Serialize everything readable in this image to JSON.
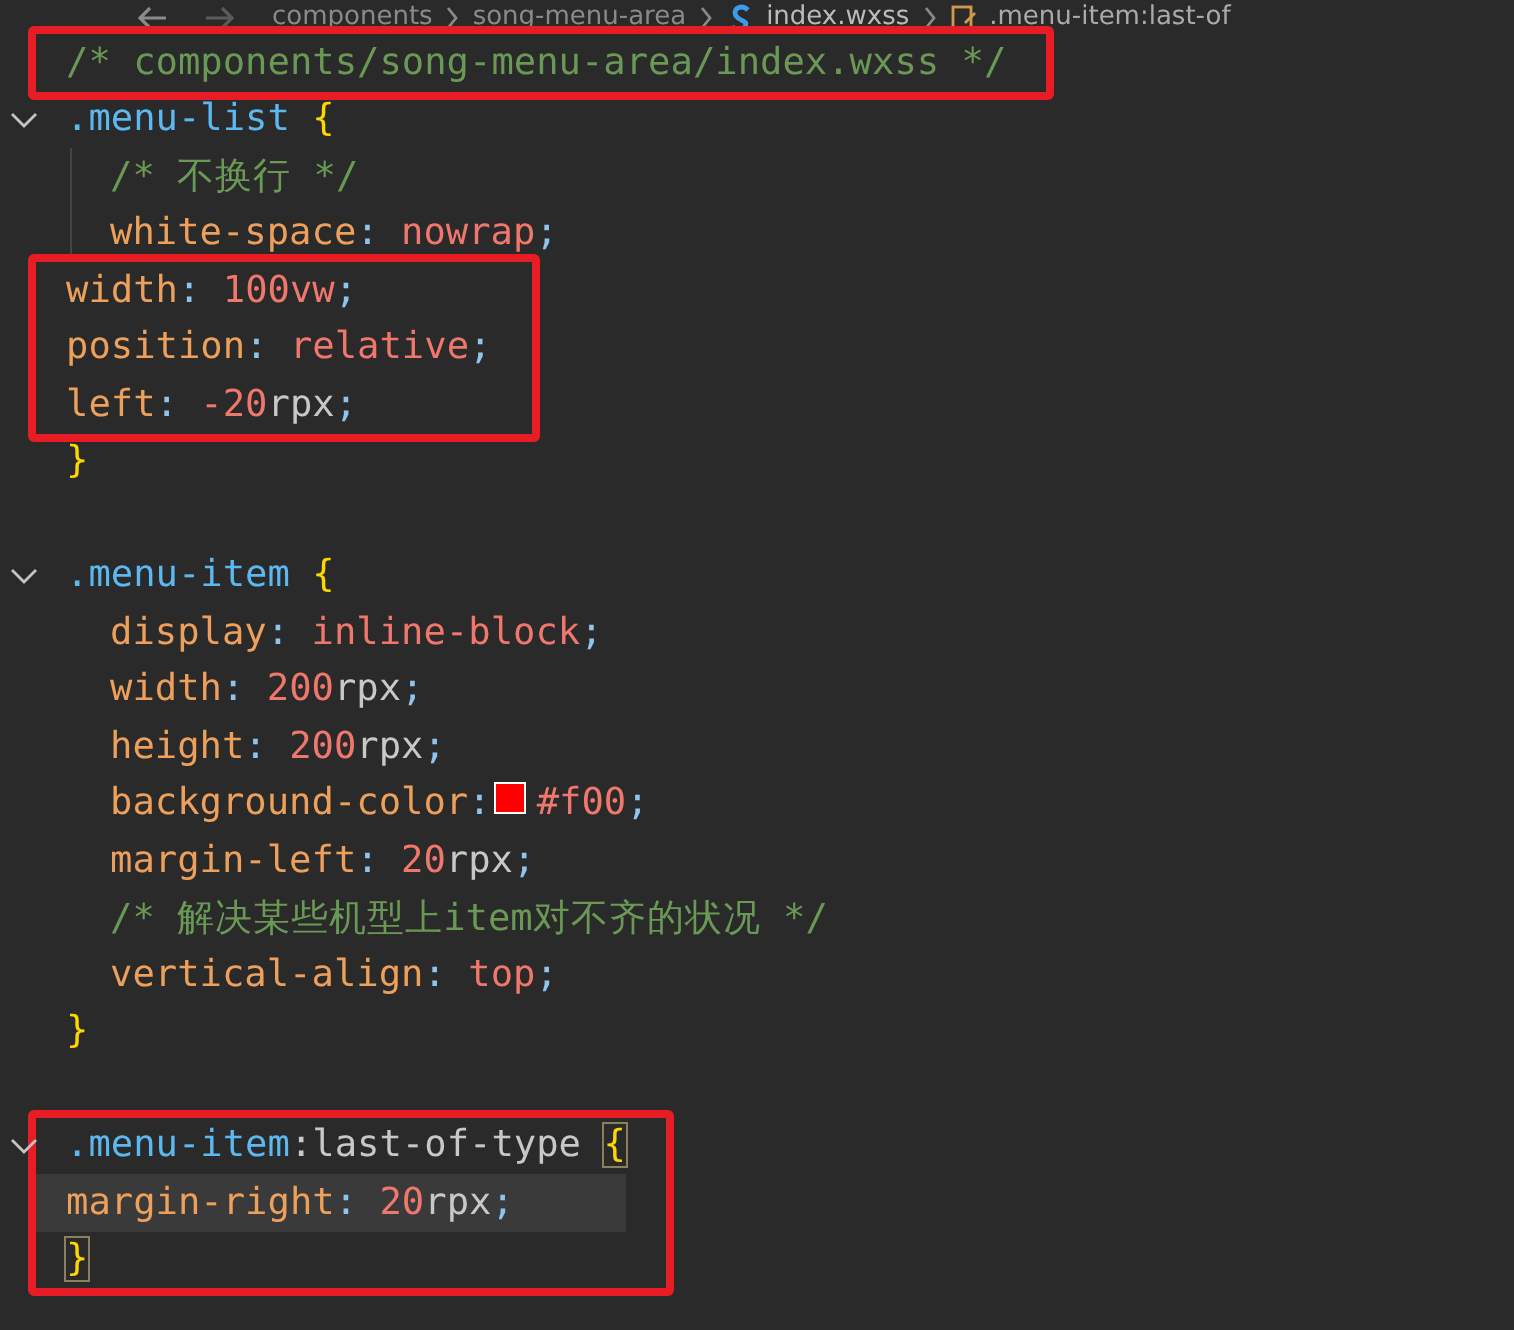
{
  "breadcrumb": [
    {
      "kind": "folder",
      "label": "components"
    },
    {
      "kind": "folder",
      "label": "song-menu-area"
    },
    {
      "kind": "file",
      "label": "index.wxss"
    },
    {
      "kind": "symbol",
      "label": ".menu-item:last-of"
    }
  ],
  "blocks": [
    {
      "boxed": true,
      "lines": [
        {
          "kind": "top",
          "tokens": [
            {
              "kind": "comment",
              "text": "/* components/song-menu-area/index.wxss */"
            }
          ]
        }
      ]
    },
    {
      "boxed": false,
      "lines": [
        {
          "kind": "rule",
          "expanded": true,
          "tokens": [
            {
              "kind": "sel",
              "text": ".menu-list"
            },
            {
              "kind": "brace",
              "text": " {"
            }
          ]
        },
        {
          "kind": "decl",
          "tokens": [
            {
              "kind": "comment",
              "text": "/* 不换行 */"
            }
          ]
        },
        {
          "kind": "decl",
          "tokens": [
            {
              "kind": "prop",
              "text": "white-space"
            },
            {
              "kind": "punct",
              "text": ": "
            },
            {
              "kind": "val",
              "text": "nowrap"
            },
            {
              "kind": "punct",
              "text": ";"
            }
          ]
        }
      ]
    },
    {
      "boxed": true,
      "lines": [
        {
          "kind": "decl",
          "tokens": [
            {
              "kind": "prop",
              "text": "width"
            },
            {
              "kind": "punct",
              "text": ": "
            },
            {
              "kind": "val",
              "text": "100vw"
            },
            {
              "kind": "punct",
              "text": ";"
            }
          ]
        },
        {
          "kind": "decl",
          "tokens": [
            {
              "kind": "prop",
              "text": "position"
            },
            {
              "kind": "punct",
              "text": ": "
            },
            {
              "kind": "val",
              "text": "relative"
            },
            {
              "kind": "punct",
              "text": ";"
            }
          ]
        },
        {
          "kind": "decl",
          "tokens": [
            {
              "kind": "prop",
              "text": "left"
            },
            {
              "kind": "punct",
              "text": ": "
            },
            {
              "kind": "val",
              "text": "-20"
            },
            {
              "kind": "unit",
              "text": "rpx"
            },
            {
              "kind": "punct",
              "text": ";"
            }
          ]
        }
      ]
    },
    {
      "boxed": false,
      "lines": [
        {
          "kind": "close",
          "tokens": [
            {
              "kind": "brace",
              "text": "}"
            }
          ]
        },
        {
          "kind": "blank"
        },
        {
          "kind": "rule",
          "expanded": true,
          "tokens": [
            {
              "kind": "sel",
              "text": ".menu-item"
            },
            {
              "kind": "brace",
              "text": " {"
            }
          ]
        },
        {
          "kind": "decl",
          "tokens": [
            {
              "kind": "prop",
              "text": "display"
            },
            {
              "kind": "punct",
              "text": ": "
            },
            {
              "kind": "val",
              "text": "inline-block"
            },
            {
              "kind": "punct",
              "text": ";"
            }
          ]
        },
        {
          "kind": "decl",
          "tokens": [
            {
              "kind": "prop",
              "text": "width"
            },
            {
              "kind": "punct",
              "text": ": "
            },
            {
              "kind": "val",
              "text": "200"
            },
            {
              "kind": "unit",
              "text": "rpx"
            },
            {
              "kind": "punct",
              "text": ";"
            }
          ]
        },
        {
          "kind": "decl",
          "tokens": [
            {
              "kind": "prop",
              "text": "height"
            },
            {
              "kind": "punct",
              "text": ": "
            },
            {
              "kind": "val",
              "text": "200"
            },
            {
              "kind": "unit",
              "text": "rpx"
            },
            {
              "kind": "punct",
              "text": ";"
            }
          ]
        },
        {
          "kind": "decl",
          "tokens": [
            {
              "kind": "prop",
              "text": "background-color"
            },
            {
              "kind": "punct",
              "text": ": "
            },
            {
              "kind": "swatch",
              "color": "#ff0000"
            },
            {
              "kind": "val",
              "text": "#f00"
            },
            {
              "kind": "punct",
              "text": ";"
            }
          ]
        },
        {
          "kind": "decl",
          "tokens": [
            {
              "kind": "prop",
              "text": "margin-left"
            },
            {
              "kind": "punct",
              "text": ": "
            },
            {
              "kind": "val",
              "text": "20"
            },
            {
              "kind": "unit",
              "text": "rpx"
            },
            {
              "kind": "punct",
              "text": ";"
            }
          ]
        },
        {
          "kind": "decl",
          "tokens": [
            {
              "kind": "comment",
              "text": "/* 解决某些机型上item对不齐的状况 */"
            }
          ]
        },
        {
          "kind": "decl",
          "tokens": [
            {
              "kind": "prop",
              "text": "vertical-align"
            },
            {
              "kind": "punct",
              "text": ": "
            },
            {
              "kind": "val",
              "text": "top"
            },
            {
              "kind": "punct",
              "text": ";"
            }
          ]
        },
        {
          "kind": "close",
          "tokens": [
            {
              "kind": "brace",
              "text": "}"
            }
          ]
        },
        {
          "kind": "blank"
        }
      ]
    },
    {
      "boxed": true,
      "lines": [
        {
          "kind": "rule",
          "expanded": true,
          "tokens": [
            {
              "kind": "sel",
              "text": ".menu-item"
            },
            {
              "kind": "pseudo",
              "text": ":last-of-type "
            },
            {
              "kind": "brace",
              "text": "{",
              "matched": true
            }
          ]
        },
        {
          "kind": "decl",
          "current": true,
          "tokens": [
            {
              "kind": "prop",
              "text": "margin-right"
            },
            {
              "kind": "punct",
              "text": ": "
            },
            {
              "kind": "val",
              "text": "20"
            },
            {
              "kind": "unit",
              "text": "rpx"
            },
            {
              "kind": "punct",
              "text": ";"
            }
          ]
        },
        {
          "kind": "close",
          "tokens": [
            {
              "kind": "brace",
              "text": "}",
              "matched": true
            }
          ]
        }
      ]
    }
  ]
}
